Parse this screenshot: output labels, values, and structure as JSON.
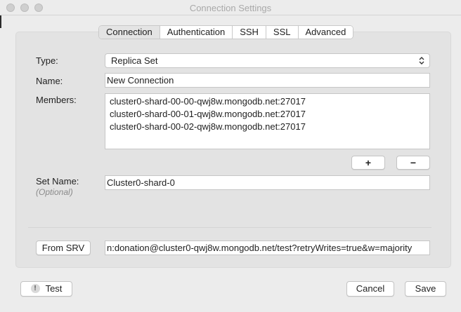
{
  "window": {
    "title": "Connection Settings"
  },
  "tabs": [
    {
      "label": "Connection",
      "active": true
    },
    {
      "label": "Authentication",
      "active": false
    },
    {
      "label": "SSH",
      "active": false
    },
    {
      "label": "SSL",
      "active": false
    },
    {
      "label": "Advanced",
      "active": false
    }
  ],
  "form": {
    "type_label": "Type:",
    "type_value": "Replica Set",
    "name_label": "Name:",
    "name_value": "New Connection",
    "members_label": "Members:",
    "members": [
      "cluster0-shard-00-00-qwj8w.mongodb.net:27017",
      "cluster0-shard-00-01-qwj8w.mongodb.net:27017",
      "cluster0-shard-00-02-qwj8w.mongodb.net:27017"
    ],
    "add_member_label": "+",
    "remove_member_label": "−",
    "set_name_label": "Set Name:",
    "set_name_hint": "(Optional)",
    "set_name_value": "Cluster0-shard-0",
    "from_srv_label": "From SRV",
    "srv_value": "n:donation@cluster0-qwj8w.mongodb.net/test?retryWrites=true&w=majority"
  },
  "footer": {
    "test_label": "Test",
    "test_icon_glyph": "!",
    "cancel_label": "Cancel",
    "save_label": "Save"
  }
}
